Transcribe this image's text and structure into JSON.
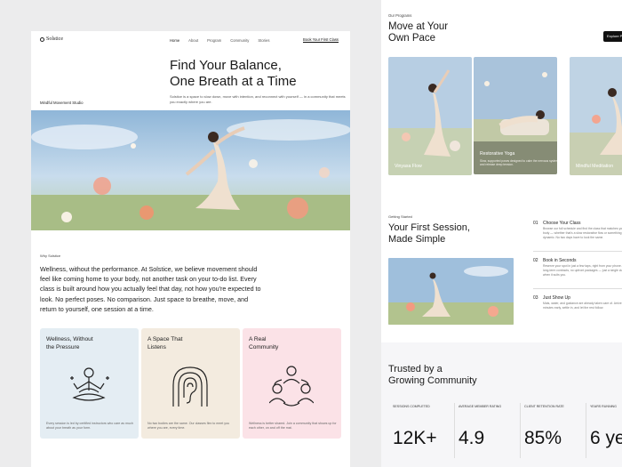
{
  "left": {
    "logo": "Solstice",
    "nav": {
      "links": [
        "Home",
        "About",
        "Program",
        "Community",
        "Stories"
      ],
      "cta": "Book Your First Class"
    },
    "hero": {
      "title_line1": "Find Your Balance,",
      "title_line2": "One Breath at a Time",
      "subtitle": "Solstice is a space to slow down, move with intention, and reconnect with yourself — in a community that meets you exactly where you are.",
      "studio_label": "Mindful Movement Studio"
    },
    "why": {
      "label": "Why Solstice",
      "body": "Wellness, without the performance. At Solstice, we believe movement should feel like coming home to your body, not another task on your to-do list. Every class is built around how you actually feel that day, not how you're expected to look. No perfect poses. No comparison. Just space to breathe, move, and return to yourself, one session at a time."
    },
    "features": [
      {
        "title_line1": "Wellness, Without",
        "title_line2": "the Pressure",
        "desc": "Every session is led by certified instructors who care as much about your breath as your form.",
        "icon": "meditation-icon"
      },
      {
        "title_line1": "A Space That",
        "title_line2": "Listens",
        "desc": "No two bodies are the same. Our classes flex to meet you where you are, every time.",
        "icon": "listening-ear-icon"
      },
      {
        "title_line1": "A Real",
        "title_line2": "Community",
        "desc": "Wellness is better shared. Join a community that shows up for each other, on and off the mat.",
        "icon": "community-icon"
      }
    ]
  },
  "right": {
    "programs": {
      "label": "Our Programs",
      "title_line1": "Move at Your",
      "title_line2": "Own Pace",
      "explore": "Explore P",
      "cards": [
        {
          "label": "Vinyasa Flow"
        },
        {
          "label": "Restorative Yoga",
          "desc": "Slow, supported poses designed to calm the nervous system and release deep tension."
        },
        {
          "label": "Mindful Meditation"
        }
      ]
    },
    "getting_started": {
      "label": "Getting Started",
      "title_line1": "Your First Session,",
      "title_line2": "Made Simple",
      "steps": [
        {
          "num": "01",
          "title": "Choose Your Class",
          "desc": "Browse our full schedule and find the class that matches your body — whether that's a slow restorative flow or something more dynamic. No two days have to look the same."
        },
        {
          "num": "02",
          "title": "Book in Seconds",
          "desc": "Reserve your spot in just a few taps, right from your phone. No long-term contracts, no upfront packages — just a single class when it suits you."
        },
        {
          "num": "03",
          "title": "Just Show Up",
          "desc": "Mats, water, and guidance are already taken care of. Arrive a few minutes early, settle in, and let the rest follow."
        }
      ]
    },
    "trust": {
      "title_line1": "Trusted by a",
      "title_line2": "Growing Community",
      "stats": [
        {
          "label": "SESSIONS COMPLETED",
          "value": "12K+"
        },
        {
          "label": "AVERAGE MEMBER RATING",
          "value": "4.9"
        },
        {
          "label": "CLIENT RETENTION RATE",
          "value": "85%"
        },
        {
          "label": "YEARS RUNNING",
          "value": "6 ye"
        }
      ]
    }
  }
}
